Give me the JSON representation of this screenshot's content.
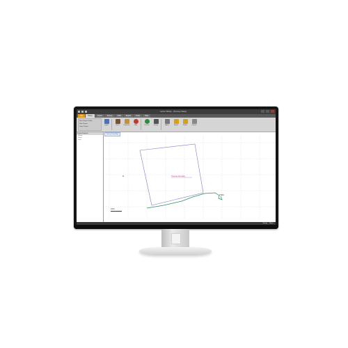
{
  "window": {
    "title": "Leica Infinity - [Survey Data]"
  },
  "ribbon_tabs": [
    "File",
    "Home",
    "Import",
    "Survey",
    "CAD",
    "Export",
    "Tools",
    "Help"
  ],
  "ribbon_left": {
    "items": [
      "New Project Folder",
      "New Project",
      "Open Project"
    ]
  },
  "ribbon_buttons": [
    {
      "label": "Import",
      "icon": "import-icon",
      "color": "#4b70b5"
    },
    {
      "label": "Points",
      "icon": "points-icon",
      "color": "#7a5230"
    },
    {
      "label": "Properties",
      "icon": "properties-icon",
      "color": "#c8912c"
    },
    {
      "label": "Help",
      "icon": "help-icon",
      "color": "#c0392b"
    },
    {
      "label": "Process",
      "icon": "process-icon",
      "color": "#2e8b3e"
    },
    {
      "label": "Survey",
      "icon": "survey-icon",
      "color": "#555555"
    },
    {
      "label": "Adjust",
      "icon": "adjust-icon",
      "color": "#777777"
    },
    {
      "label": "Report",
      "icon": "report-icon",
      "color": "#d4a017"
    },
    {
      "label": "Export",
      "icon": "export-icon",
      "color": "#d4a017"
    },
    {
      "label": "Options",
      "icon": "options-icon",
      "color": "#888888"
    }
  ],
  "sidebar": {
    "header": "Project Explorer",
    "items": [
      "Survey",
      "Points",
      "Lines"
    ]
  },
  "document": {
    "tab_label": "Survey Data Map"
  },
  "map": {
    "annotation": "Traverse boundary",
    "point_label": "P1001",
    "scale_label": "100m",
    "colors": {
      "boundary": "#7c7cc9",
      "traverse": "#2f8a5b",
      "label": "#b03a8a"
    }
  },
  "status": {
    "coords": "Ready",
    "units": "Metric"
  }
}
